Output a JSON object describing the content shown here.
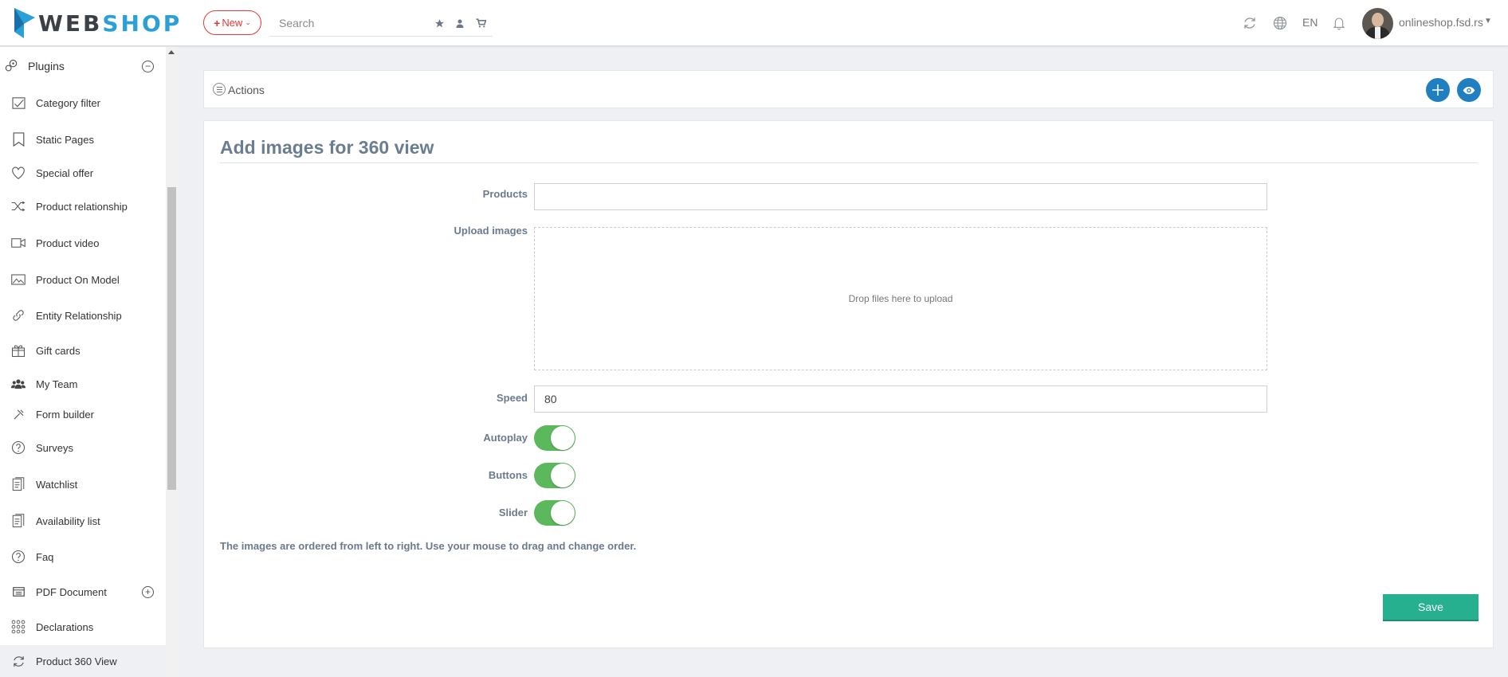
{
  "header": {
    "logo": {
      "part1": "WEB",
      "part2": "SHOP"
    },
    "new_button": {
      "icon": "plus-icon",
      "label": "New"
    },
    "search": {
      "placeholder": "Search"
    },
    "language": "EN",
    "user": {
      "name": "onlineshop.fsd.rs"
    }
  },
  "sidebar": {
    "section": {
      "label": "Plugins",
      "icon": "plugins-icon"
    },
    "items": [
      {
        "label": "Category filter",
        "icon": "category-filter-icon"
      },
      {
        "label": "Static Pages",
        "icon": "static-pages-icon"
      },
      {
        "label": "Special offer",
        "icon": "heart-icon"
      },
      {
        "label": "Product relationship",
        "icon": "shuffle-icon"
      },
      {
        "label": "Product video",
        "icon": "video-icon"
      },
      {
        "label": "Product On Model",
        "icon": "image-icon"
      },
      {
        "label": "Entity Relationship",
        "icon": "link-icon"
      },
      {
        "label": "Gift cards",
        "icon": "gift-icon"
      },
      {
        "label": "My Team",
        "icon": "team-icon"
      },
      {
        "label": "Form builder",
        "icon": "tools-icon"
      },
      {
        "label": "Surveys",
        "icon": "question-icon"
      },
      {
        "label": "Watchlist",
        "icon": "watchlist-icon"
      },
      {
        "label": "Availability list",
        "icon": "availability-list-icon"
      },
      {
        "label": "Faq",
        "icon": "question-icon"
      },
      {
        "label": "PDF Document",
        "icon": "pdf-document-icon"
      },
      {
        "label": "Declarations",
        "icon": "grid-icon"
      },
      {
        "label": "Product 360 View",
        "icon": "rotate-icon"
      }
    ]
  },
  "actions": {
    "label": "Actions"
  },
  "form": {
    "title": "Add images for 360 view",
    "products_label": "Products",
    "products_value": "",
    "upload_label": "Upload images",
    "dropzone_text": "Drop files here to upload",
    "speed_label": "Speed",
    "speed_value": "80",
    "autoplay_label": "Autoplay",
    "autoplay_on": true,
    "buttons_label": "Buttons",
    "buttons_on": true,
    "slider_label": "Slider",
    "slider_on": true,
    "note": "The images are ordered from left to right. Use your mouse to drag and change order.",
    "save_label": "Save"
  },
  "colors": {
    "accent_blue": "#1f7fc0",
    "toggle_green": "#5cb85c",
    "save_green": "#26b08f",
    "new_red": "#e53935",
    "logo_blue": "#2aa0d6"
  }
}
